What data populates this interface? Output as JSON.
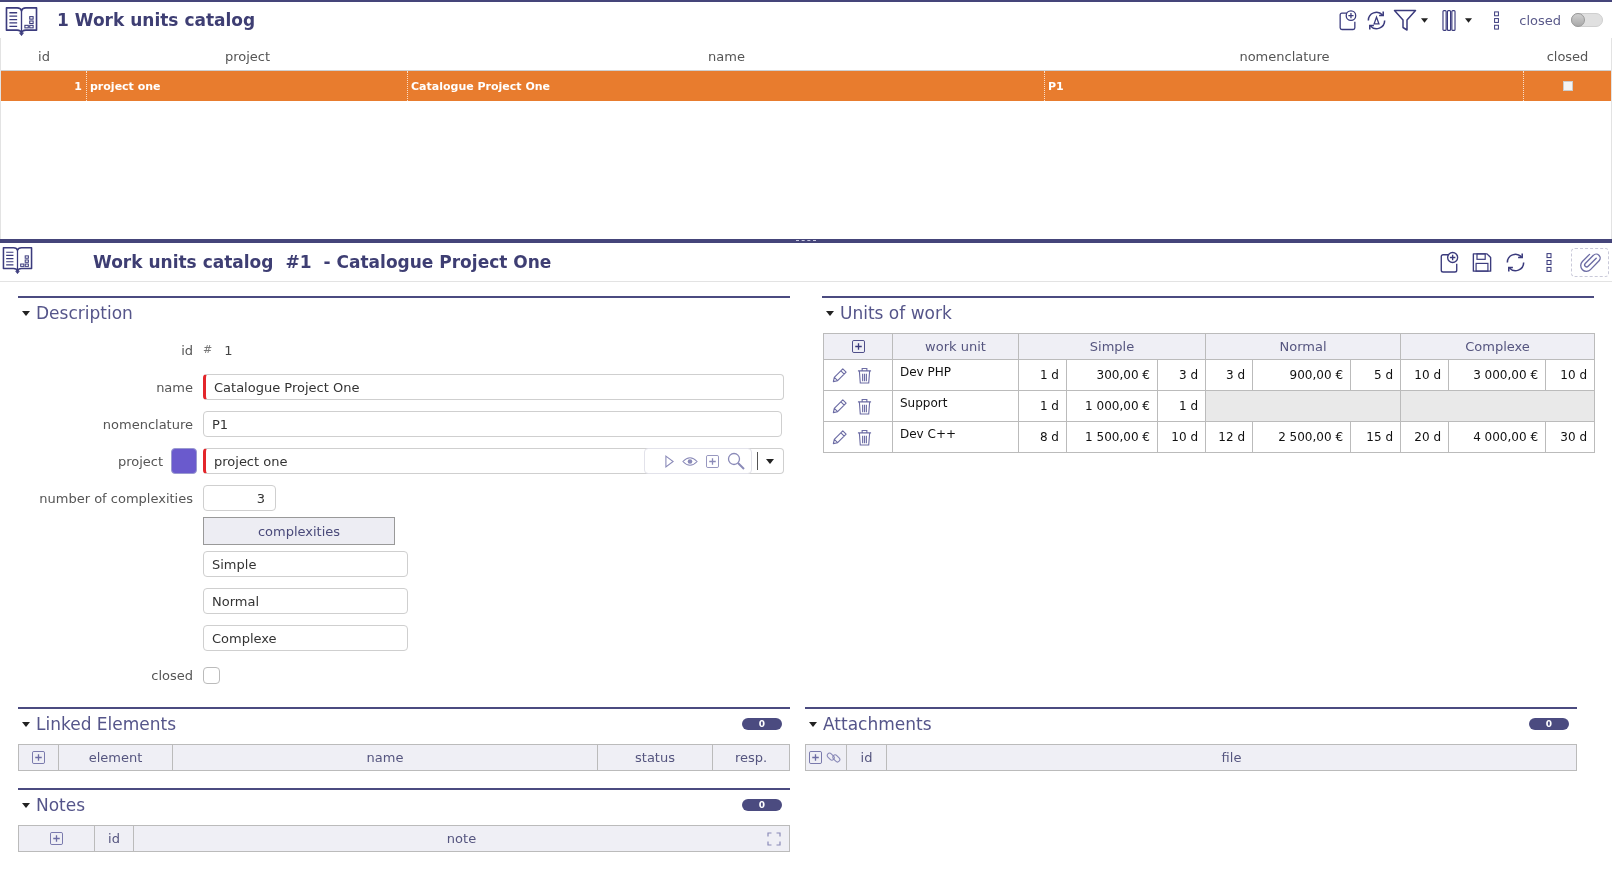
{
  "list_view": {
    "title": "1 Work units catalog",
    "closed_filter": {
      "label": "closed",
      "on": false
    },
    "columns": [
      "id",
      "project",
      "name",
      "nomenclature",
      "closed"
    ],
    "rows": [
      {
        "id": "1",
        "project": "project one",
        "name": "Catalogue Project One",
        "nomenclature": "P1",
        "closed": false,
        "selected": true
      }
    ]
  },
  "detail": {
    "title": "Work units catalog",
    "number": "#1",
    "subtitle": "- Catalogue Project One"
  },
  "description": {
    "title": "Description",
    "expanded": true,
    "id": {
      "label": "id",
      "prefix": "#",
      "value": "1"
    },
    "name": {
      "label": "name",
      "value": "Catalogue Project One",
      "required": true
    },
    "nomenclature": {
      "label": "nomenclature",
      "value": "P1",
      "required": false
    },
    "project": {
      "label": "project",
      "value": "project one",
      "color": "#6a5acd",
      "required": true
    },
    "complexity_count": {
      "label": "number of complexities",
      "value": "3"
    },
    "complexities": {
      "header": "complexities",
      "values": [
        "Simple",
        "Normal",
        "Complexe"
      ]
    },
    "closed": {
      "label": "closed",
      "checked": false
    }
  },
  "units_of_work": {
    "title": "Units of work",
    "expanded": true,
    "columns": {
      "work_unit": "work unit",
      "complexities": [
        "Simple",
        "Normal",
        "Complexe"
      ]
    },
    "rows": [
      {
        "name": "Dev PHP",
        "values": [
          {
            "kind": "set",
            "cells": [
              "1 d",
              "300,00 €",
              "3 d"
            ]
          },
          {
            "kind": "set",
            "cells": [
              "3 d",
              "900,00 €",
              "5 d"
            ]
          },
          {
            "kind": "set",
            "cells": [
              "10 d",
              "3 000,00 €",
              "10 d"
            ]
          }
        ]
      },
      {
        "name": "Support",
        "values": [
          {
            "kind": "set",
            "cells": [
              "1 d",
              "1 000,00 €",
              "1 d"
            ]
          },
          {
            "kind": "unset"
          },
          {
            "kind": "unset"
          }
        ]
      },
      {
        "name": "Dev C++",
        "values": [
          {
            "kind": "set",
            "cells": [
              "8 d",
              "1 500,00 €",
              "10 d"
            ]
          },
          {
            "kind": "set",
            "cells": [
              "12 d",
              "2 500,00 €",
              "15 d"
            ]
          },
          {
            "kind": "set",
            "cells": [
              "20 d",
              "4 000,00 €",
              "30 d"
            ]
          }
        ]
      }
    ]
  },
  "linked_elements": {
    "title": "Linked Elements",
    "expanded": true,
    "count": "0",
    "columns": [
      "element",
      "name",
      "status",
      "resp."
    ]
  },
  "attachments": {
    "title": "Attachments",
    "expanded": true,
    "count": "0",
    "columns": [
      "id",
      "file"
    ]
  },
  "notes": {
    "title": "Notes",
    "expanded": true,
    "count": "0",
    "columns": [
      "id",
      "note"
    ]
  }
}
